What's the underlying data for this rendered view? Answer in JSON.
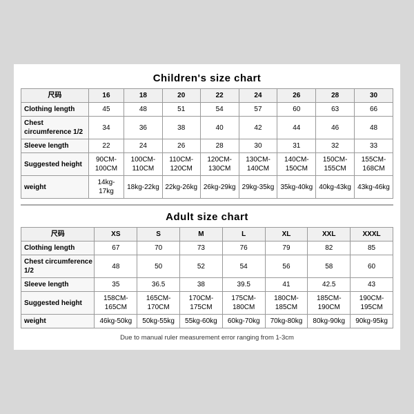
{
  "children_title": "Children's size chart",
  "adult_title": "Adult size chart",
  "footnote": "Due to manual ruler measurement error ranging from 1-3cm",
  "children": {
    "header_label": "尺码",
    "sizes": [
      "16",
      "18",
      "20",
      "22",
      "24",
      "26",
      "28",
      "30"
    ],
    "rows": [
      {
        "label": "Clothing length",
        "values": [
          "45",
          "48",
          "51",
          "54",
          "57",
          "60",
          "63",
          "66"
        ]
      },
      {
        "label": "Chest circumference 1/2",
        "values": [
          "34",
          "36",
          "38",
          "40",
          "42",
          "44",
          "46",
          "48"
        ]
      },
      {
        "label": "Sleeve length",
        "values": [
          "22",
          "24",
          "26",
          "28",
          "30",
          "31",
          "32",
          "33"
        ]
      },
      {
        "label": "Suggested height",
        "values": [
          "90CM-100CM",
          "100CM-110CM",
          "110CM-120CM",
          "120CM-130CM",
          "130CM-140CM",
          "140CM-150CM",
          "150CM-155CM",
          "155CM-168CM"
        ]
      },
      {
        "label": "weight",
        "values": [
          "14kg-17kg",
          "18kg-22kg",
          "22kg-26kg",
          "26kg-29kg",
          "29kg-35kg",
          "35kg-40kg",
          "40kg-43kg",
          "43kg-46kg"
        ]
      }
    ]
  },
  "adult": {
    "header_label": "尺码",
    "sizes": [
      "XS",
      "S",
      "M",
      "L",
      "XL",
      "XXL",
      "XXXL"
    ],
    "rows": [
      {
        "label": "Clothing length",
        "values": [
          "67",
          "70",
          "73",
          "76",
          "79",
          "82",
          "85"
        ]
      },
      {
        "label": "Chest circumference 1/2",
        "values": [
          "48",
          "50",
          "52",
          "54",
          "56",
          "58",
          "60"
        ]
      },
      {
        "label": "Sleeve length",
        "values": [
          "35",
          "36.5",
          "38",
          "39.5",
          "41",
          "42.5",
          "43"
        ]
      },
      {
        "label": "Suggested height",
        "values": [
          "158CM-165CM",
          "165CM-170CM",
          "170CM-175CM",
          "175CM-180CM",
          "180CM-185CM",
          "185CM-190CM",
          "190CM-195CM"
        ]
      },
      {
        "label": "weight",
        "values": [
          "46kg-50kg",
          "50kg-55kg",
          "55kg-60kg",
          "60kg-70kg",
          "70kg-80kg",
          "80kg-90kg",
          "90kg-95kg"
        ]
      }
    ]
  }
}
